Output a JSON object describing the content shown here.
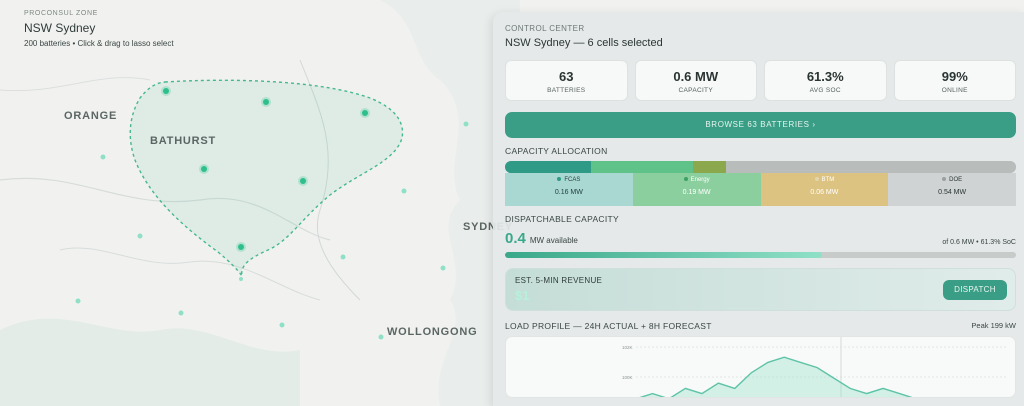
{
  "map": {
    "zone_label": "PROCONSUL ZONE",
    "zone_name": "NSW Sydney",
    "zone_subtitle": "200 batteries • Click & drag to lasso select",
    "cities": {
      "orange": "ORANGE",
      "bathurst": "BATHURST",
      "sydney": "SYDNEY",
      "wollongong": "WOLLONGONG"
    },
    "colors": {
      "battery": "#3fbf95",
      "lasso": "#46b88f"
    }
  },
  "panel": {
    "label": "CONTROL CENTER",
    "title": "NSW Sydney — 6 cells selected",
    "stats": [
      {
        "value": "63",
        "label": "BATTERIES"
      },
      {
        "value": "0.6 MW",
        "label": "CAPACITY"
      },
      {
        "value": "61.3%",
        "label": "AVG SOC"
      },
      {
        "value": "99%",
        "label": "ONLINE"
      }
    ],
    "browse_label": "BROWSE 63 BATTERIES ›",
    "capacity_title": "CAPACITY ALLOCATION",
    "allocation": [
      {
        "name": "FCAS",
        "value": "0.16 MW",
        "color": "#2f9a86",
        "box": "#a9d7d2",
        "dot": "#2f9a86",
        "text": "#24413c",
        "mw": 0.16
      },
      {
        "name": "Energy",
        "value": "0.19 MW",
        "color": "#5fc389",
        "box": "#8ccf9e",
        "dot": "#3ea163",
        "text": "#ffffff",
        "mw": 0.19
      },
      {
        "name": "BTM",
        "value": "0.06 MW",
        "color": "#8ba84d",
        "box": "#ddc382",
        "dot": "#e4d5ab",
        "text": "#ffffff",
        "mw": 0.06
      },
      {
        "name": "DOE",
        "value": "0.54 MW",
        "color": "#b8bdbc",
        "box": "#cfd3d3",
        "dot": "#9aa09f",
        "text": "#2a3533",
        "mw": 0.54
      }
    ],
    "dispatchable_title": "DISPATCHABLE CAPACITY",
    "dispatchable_value": "0.4",
    "dispatchable_unit": "MW available",
    "dispatchable_of": "of 0.6 MW • 61.3% SoC",
    "dispatchable_fraction": 0.62,
    "revenue_label": "EST. 5-MIN REVENUE",
    "revenue_value": "$1",
    "dispatch_label": "DISPATCH",
    "load_title": "LOAD PROFILE — 24H ACTUAL + 8H FORECAST",
    "load_peak": "Peak 199 kW"
  },
  "chart_data": {
    "type": "line",
    "y_ticks": [
      "102K",
      "100K"
    ],
    "series": [
      {
        "values": [
          96,
          97,
          96,
          98,
          97,
          99,
          98,
          101,
          103,
          104,
          103,
          102,
          100,
          98,
          97,
          98,
          97,
          96
        ]
      }
    ]
  }
}
